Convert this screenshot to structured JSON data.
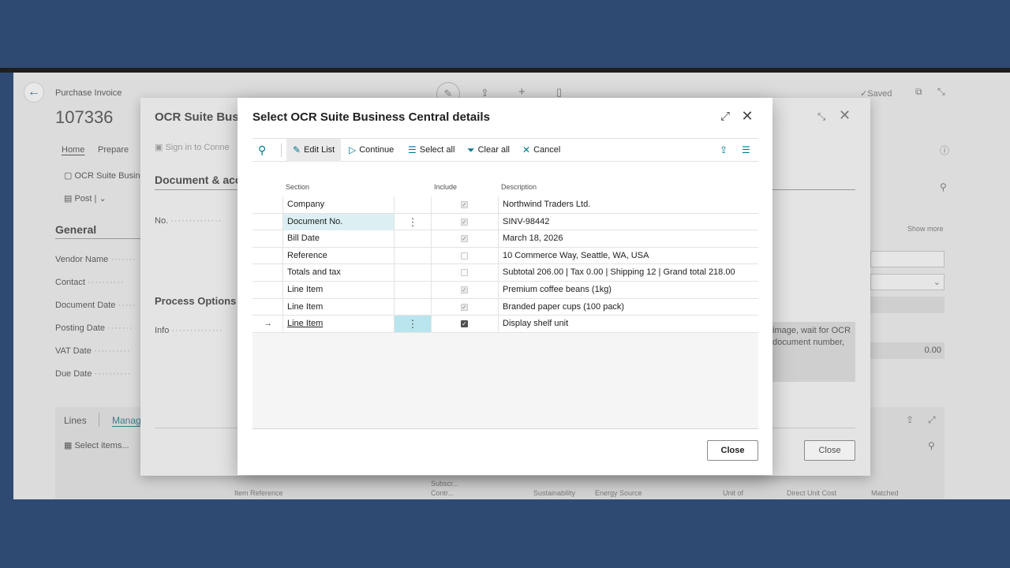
{
  "page": {
    "breadcrumb": "Purchase Invoice",
    "doc_number": "107336",
    "saved_label": "Saved",
    "tabs": {
      "home": "Home",
      "prepare": "Prepare"
    },
    "actions": {
      "ocr": "OCR Suite Busine",
      "post": "Post"
    },
    "general_heading": "General",
    "show_more": "Show more",
    "fields": [
      "Vendor Name",
      "Contact",
      "Document Date",
      "Posting Date",
      "VAT Date",
      "Due Date"
    ],
    "vat_value": "0.00",
    "lines_tab": "Lines",
    "manage_tab": "Manage",
    "select_items": "Select items...",
    "col_headers": [
      "Item Reference",
      "Subscr...",
      "Contr...",
      "Sustainability",
      "Energy Source",
      "Unit of",
      "Direct Unit Cost",
      "Matched"
    ]
  },
  "mid_modal": {
    "title": "OCR Suite Busi",
    "sign_in": "Sign in to Conne",
    "section1": "Document & acc",
    "no_label": "No.",
    "section2": "Process Options",
    "info_label": "Info",
    "info_text": "image, wait for OCR document number,",
    "close_label": "Close"
  },
  "dialog": {
    "title": "Select OCR Suite Business Central details",
    "toolbar": {
      "edit_list": "Edit List",
      "continue": "Continue",
      "select_all": "Select all",
      "clear_all": "Clear all",
      "cancel": "Cancel"
    },
    "columns": {
      "section": "Section",
      "include": "Include",
      "description": "Description"
    },
    "rows": [
      {
        "section": "Company",
        "include": true,
        "description": "Northwind Traders Ltd."
      },
      {
        "section": "Document No.",
        "include": true,
        "description": "SINV-98442"
      },
      {
        "section": "Bill Date",
        "include": true,
        "description": "March 18, 2026"
      },
      {
        "section": "Reference",
        "include": false,
        "description": "10 Commerce Way, Seattle, WA, USA"
      },
      {
        "section": "Totals and tax",
        "include": false,
        "description": "Subtotal 206.00 | Tax 0.00 | Shipping 12 | Grand total 218.00"
      },
      {
        "section": "Line Item",
        "include": true,
        "description": "Premium coffee beans (1kg)"
      },
      {
        "section": "Line Item",
        "include": true,
        "description": "Branded paper cups (100 pack)"
      },
      {
        "section": "Line Item",
        "include": true,
        "description": "Display shelf unit"
      }
    ],
    "close_label": "Close"
  },
  "colors": {
    "accent": "#00788a",
    "frame": "#2e4a72",
    "selected_cell": "#dceff3",
    "active_cell": "#b9e6ee"
  }
}
